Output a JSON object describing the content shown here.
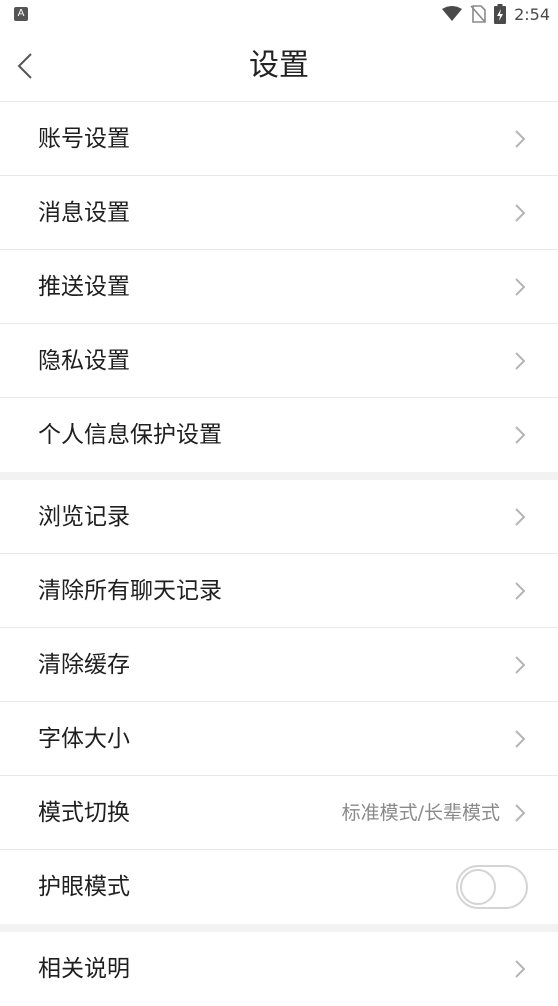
{
  "status_bar": {
    "app_badge": "A",
    "time": "2:54"
  },
  "header": {
    "title": "设置"
  },
  "groups": [
    {
      "items": [
        {
          "label": "账号设置"
        },
        {
          "label": "消息设置"
        },
        {
          "label": "推送设置"
        },
        {
          "label": "隐私设置"
        },
        {
          "label": "个人信息保护设置"
        }
      ]
    },
    {
      "items": [
        {
          "label": "浏览记录"
        },
        {
          "label": "清除所有聊天记录"
        },
        {
          "label": "清除缓存"
        },
        {
          "label": "字体大小"
        },
        {
          "label": "模式切换",
          "value": "标准模式/长辈模式"
        },
        {
          "label": "护眼模式",
          "toggle": false
        }
      ]
    },
    {
      "items": [
        {
          "label": "相关说明"
        }
      ]
    }
  ]
}
